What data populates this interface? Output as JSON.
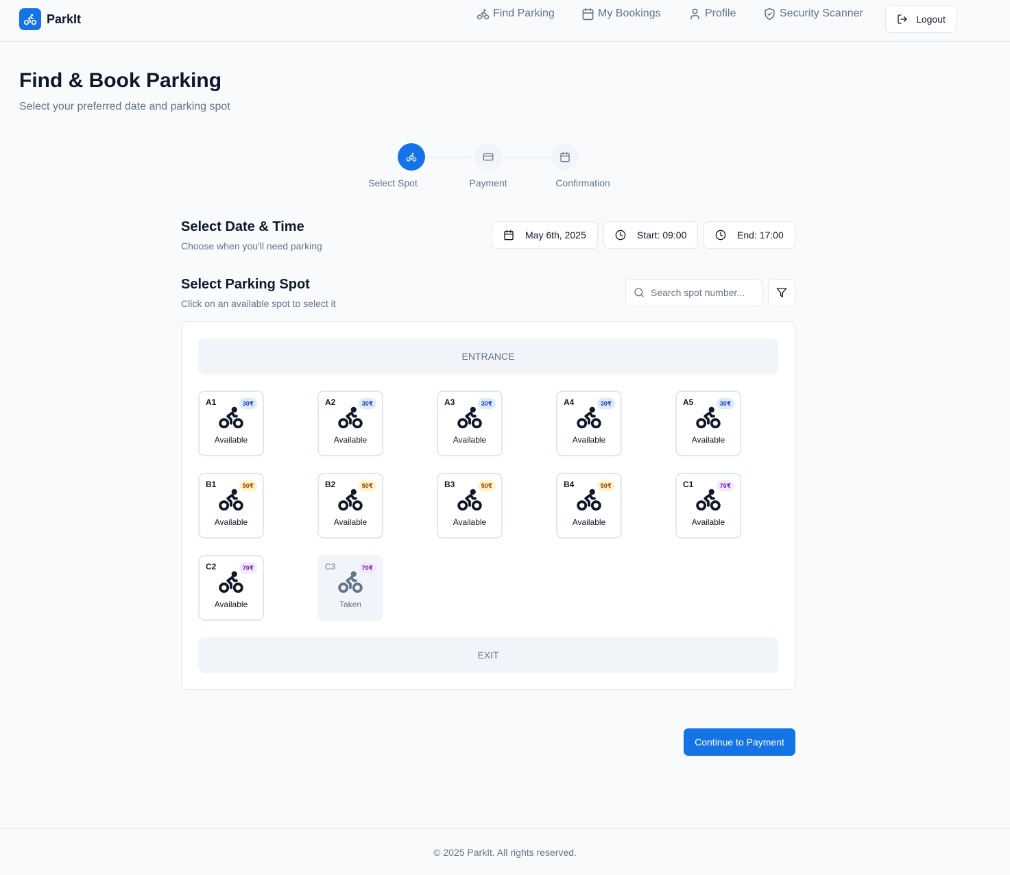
{
  "brand": {
    "name": "ParkIt",
    "icon": "bike-icon",
    "color": "#1473e6"
  },
  "nav": {
    "items": [
      {
        "label": "Find Parking",
        "icon": "bike-icon"
      },
      {
        "label": "My Bookings",
        "icon": "calendar-icon"
      },
      {
        "label": "Profile",
        "icon": "user-icon"
      },
      {
        "label": "Security Scanner",
        "icon": "shield-check-icon"
      }
    ],
    "logout_label": "Logout"
  },
  "page": {
    "title": "Find & Book Parking",
    "subtitle": "Select your preferred date and parking spot"
  },
  "stepper": {
    "steps": [
      {
        "label": "Select Spot",
        "icon": "bike-icon",
        "active": true
      },
      {
        "label": "Payment",
        "icon": "credit-card-icon",
        "active": false
      },
      {
        "label": "Confirmation",
        "icon": "calendar-icon",
        "active": false
      }
    ]
  },
  "datetime": {
    "title": "Select Date & Time",
    "description": "Choose when you'll need parking",
    "date": "May 6th, 2025",
    "start": "Start: 09:00",
    "end": "End: 17:00"
  },
  "spot_select": {
    "title": "Select Parking Spot",
    "description": "Click on an available spot to select it",
    "search_placeholder": "Search spot number..."
  },
  "lot": {
    "entrance_label": "ENTRANCE",
    "exit_label": "EXIT",
    "spots": [
      {
        "id": "A1",
        "price": "30₹",
        "tier": "blue",
        "status": "Available"
      },
      {
        "id": "A2",
        "price": "30₹",
        "tier": "blue",
        "status": "Available"
      },
      {
        "id": "A3",
        "price": "30₹",
        "tier": "blue",
        "status": "Available"
      },
      {
        "id": "A4",
        "price": "30₹",
        "tier": "blue",
        "status": "Available"
      },
      {
        "id": "A5",
        "price": "30₹",
        "tier": "blue",
        "status": "Available"
      },
      {
        "id": "B1",
        "price": "50₹",
        "tier": "yellow",
        "status": "Available"
      },
      {
        "id": "B2",
        "price": "50₹",
        "tier": "yellow",
        "status": "Available"
      },
      {
        "id": "B3",
        "price": "50₹",
        "tier": "yellow",
        "status": "Available"
      },
      {
        "id": "B4",
        "price": "50₹",
        "tier": "yellow",
        "status": "Available"
      },
      {
        "id": "C1",
        "price": "70₹",
        "tier": "purple",
        "status": "Available"
      },
      {
        "id": "C2",
        "price": "70₹",
        "tier": "purple",
        "status": "Available"
      },
      {
        "id": "C3",
        "price": "70₹",
        "tier": "purple",
        "status": "Taken"
      }
    ]
  },
  "actions": {
    "continue_label": "Continue to Payment"
  },
  "footer": {
    "text": "© 2025 ParkIt. All rights reserved."
  }
}
